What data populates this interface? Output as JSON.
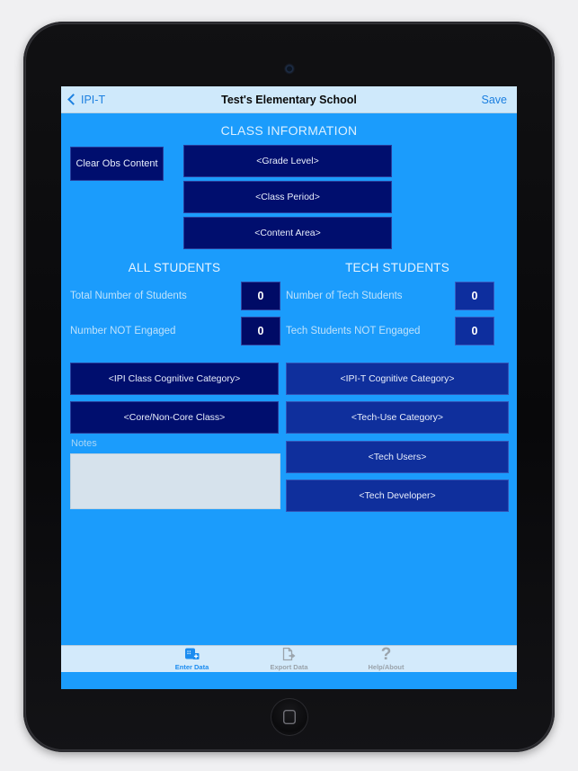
{
  "navbar": {
    "back_label": "IPI-T",
    "title": "Test's Elementary School",
    "save_label": "Save",
    "back_icon": "chevron-left-icon"
  },
  "class_information": {
    "section_title": "CLASS INFORMATION",
    "clear_button": "Clear Obs Content",
    "grade_level": "<Grade Level>",
    "class_period": "<Class Period>",
    "content_area": "<Content Area>"
  },
  "all_students": {
    "header": "ALL STUDENTS",
    "total_label": "Total Number of Students",
    "total_value": "0",
    "not_engaged_label": "Number NOT Engaged",
    "not_engaged_value": "0",
    "cognitive_category": "<IPI Class Cognitive Category>",
    "core_class": "<Core/Non-Core Class>"
  },
  "tech_students": {
    "header": "TECH STUDENTS",
    "number_label": "Number of Tech Students",
    "number_value": "0",
    "not_engaged_label": "Tech Students NOT Engaged",
    "not_engaged_value": "0",
    "cognitive_category": "<IPI-T Cognitive Category>",
    "tech_use_category": "<Tech-Use Category>",
    "tech_users": "<Tech Users>",
    "tech_developer": "<Tech Developer>"
  },
  "notes": {
    "label": "Notes",
    "value": "",
    "placeholder": ""
  },
  "tabbar": {
    "tabs": [
      {
        "label": "Enter Data",
        "icon": "enter-data-icon",
        "active": true
      },
      {
        "label": "Export Data",
        "icon": "export-data-icon",
        "active": false
      },
      {
        "label": "Help/About",
        "icon": "question-mark-icon",
        "active": false
      }
    ]
  },
  "colors": {
    "screen_background": "#1b9cfc",
    "navbar_background": "#cfe9fb",
    "navy_button": "#000e6e",
    "blue_button": "#0f2f9c",
    "accent_link": "#1b7fe0",
    "notes_field": "#d6e2ec",
    "active_tab": "#1b8cf0",
    "idle_tab": "#9aa3ab"
  }
}
